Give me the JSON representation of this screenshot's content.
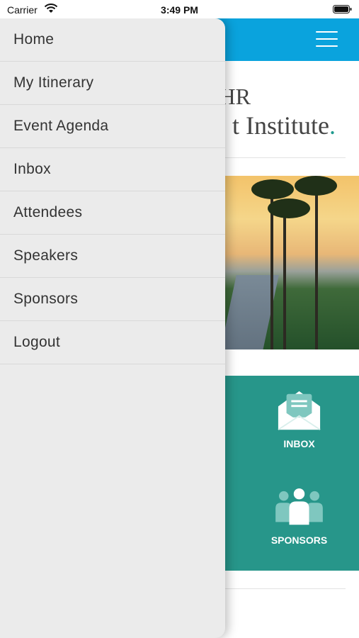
{
  "status_bar": {
    "carrier": "Carrier",
    "time": "3:49 PM"
  },
  "drawer": {
    "items": [
      {
        "label": "Home"
      },
      {
        "label": "My Itinerary"
      },
      {
        "label": "Event Agenda"
      },
      {
        "label": "Inbox"
      },
      {
        "label": "Attendees"
      },
      {
        "label": "Speakers"
      },
      {
        "label": "Sponsors"
      },
      {
        "label": "Logout"
      }
    ]
  },
  "brand": {
    "line1": "HR",
    "line2": "t Institute",
    "dot": "."
  },
  "tiles": {
    "inbox_label": "INBOX",
    "sponsors_label": "SPONSORS"
  },
  "colors": {
    "header": "#0aa3dd",
    "teal_panel": "#27968a",
    "drawer_bg": "#ebebeb"
  },
  "icons": {
    "menu": "hamburger-icon",
    "inbox": "envelope-icon",
    "sponsors": "people-group-icon"
  }
}
